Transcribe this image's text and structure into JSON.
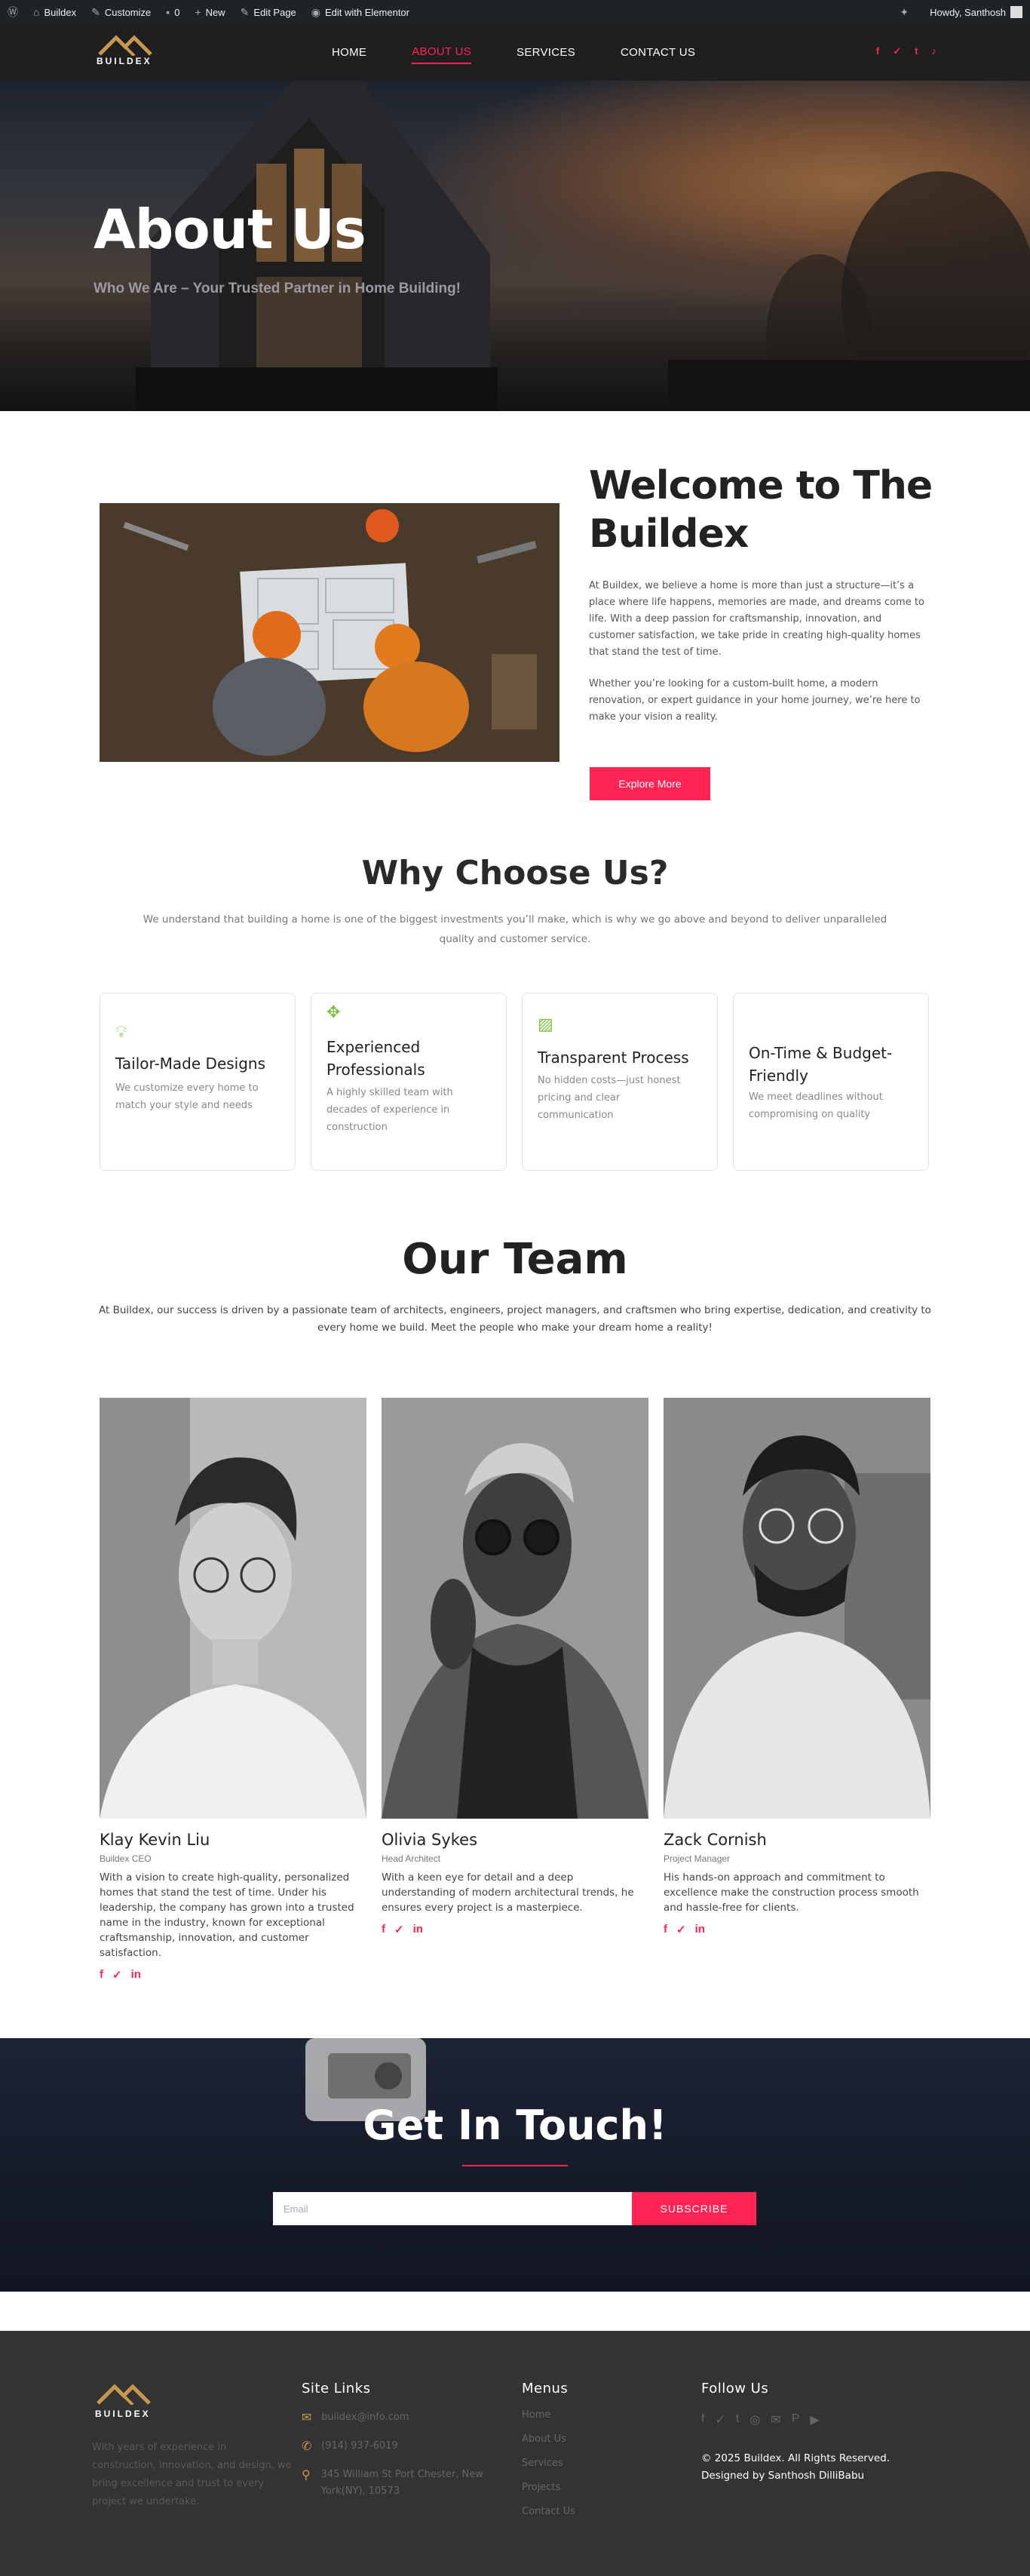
{
  "adminbar": {
    "site": "Buildex",
    "customize": "Customize",
    "comments": "0",
    "new": "New",
    "edit_page": "Edit Page",
    "elementor": "Edit with Elementor",
    "howdy": "Howdy, Santhosh"
  },
  "brand": {
    "logo_text": "BUILDEX",
    "accent": "#ff2453",
    "logo_color": "#c99850"
  },
  "nav": {
    "items": [
      "HOME",
      "ABOUT US",
      "SERVICES",
      "CONTACT US"
    ],
    "active": "ABOUT US"
  },
  "socials_top": [
    "f",
    "✓",
    "t",
    "♪"
  ],
  "hero": {
    "title": "About Us",
    "subtitle": "Who We Are – Your Trusted Partner in Home Building!"
  },
  "welcome": {
    "title": "Welcome to The Buildex",
    "p1": "At Buildex, we believe a home is more than just a structure—it’s a place where life happens, memories are made, and dreams come to life. With a deep passion for craftsmanship, innovation, and customer satisfaction, we take pride in creating high-quality homes that stand the test of time.",
    "p2": "Whether you’re looking for a custom-built home, a modern renovation, or expert guidance in your home journey, we’re here to make your vision a reality.",
    "button": "Explore More"
  },
  "why": {
    "title": "Why Choose Us?",
    "text": "We understand that building a home is one of the biggest investments you’ll make, which is why we go above and beyond to deliver unparalleled quality and customer service.",
    "cards": [
      {
        "icon": "lightbulb-icon",
        "title": "Tailor-Made Designs",
        "text": "We customize every home to match your style and needs"
      },
      {
        "icon": "tools-icon",
        "title": "Experienced Professionals",
        "text": "A highly skilled team with decades of experience in construction"
      },
      {
        "icon": "map-icon",
        "title": "Transparent Process",
        "text": "No hidden costs—just honest pricing and clear communication"
      },
      {
        "icon": "clock-icon",
        "title": "On-Time & Budget-Friendly",
        "text": "We meet deadlines without compromising on quality"
      }
    ]
  },
  "team": {
    "title": "Our Team",
    "text": "At Buildex, our success is driven by a passionate team of architects, engineers, project managers, and craftsmen who bring expertise, dedication, and creativity to every home we build. Meet the people who make your dream home a reality!",
    "members": [
      {
        "name": "Klay Kevin Liu",
        "role": "Buildex CEO",
        "bio": "With a vision to create high-quality, personalized homes that stand the test of time. Under his leadership, the company has grown into a trusted name in the industry, known for exceptional craftsmanship, innovation, and customer satisfaction."
      },
      {
        "name": "Olivia Sykes",
        "role": "Head Architect",
        "bio": "With a keen eye for detail and a deep understanding of modern architectural trends, he ensures every project is a masterpiece."
      },
      {
        "name": "Zack Cornish",
        "role": "Project Manager",
        "bio": "His hands-on approach and commitment to excellence make the construction process smooth and hassle-free for clients."
      }
    ],
    "social": [
      "f",
      "✓",
      "in"
    ]
  },
  "touch": {
    "title": "Get In Touch!",
    "placeholder": "Email",
    "button": "SUBSCRIBE"
  },
  "footer": {
    "about": "With years of experience in construction, innovation, and design, we bring excellence and trust to every project we undertake.",
    "site_links_title": "Site Links",
    "email": "buildex@info.com",
    "phone": "(914) 937-6019",
    "address": "345 William St Port Chester, New York(NY), 10573",
    "menus_title": "Menus",
    "menus": [
      "Home",
      "About Us",
      "Services",
      "Projects",
      "Contact Us"
    ],
    "follow_title": "Follow Us",
    "follow_icons": [
      "f",
      "✓",
      "t",
      "◎",
      "✉",
      "P",
      "▶"
    ],
    "copyright": "© 2025 Buildex. All Rights Reserved. Designed by Santhosh DilliBabu"
  }
}
